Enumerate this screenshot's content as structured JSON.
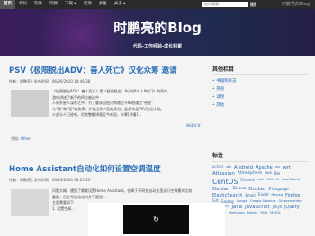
{
  "nav": {
    "items": [
      "首页",
      "代码",
      "软件",
      "玩物",
      "下载 ▾",
      "资源",
      "手册",
      "关于 ▾"
    ],
    "search_placeholder": "站内搜索...",
    "search_button": "搜索",
    "site_name": "时鹏亮的Blog"
  },
  "banner": {
    "title": "时鹏亮的Blog",
    "subtitle": "代码-工作经验-成长积累"
  },
  "posts": [
    {
      "title": "PSV《极限脱出ADV：善人死亡》汉化众筹 邀请",
      "meta": "作者：时鹏亮 | 发布时间：06/26/2020 14:46:38",
      "excerpt": [
        "《极限脱出ADV：善人死亡》是《极限脱出：9小时9个人9扇门》的续作。",
        "游戏讲述了新手的四位被选中",
        "人同外星人谋杀之中，为了重获自由只得通过不断地通过“密室”",
        "与“善”和“恶”的抉择，并找出杀人犯的身份。此部作品PSV汉化计划。",
        "少部分人已经有，但完整翻译版至今难觅，众筹[详情]..."
      ],
      "readmore": "阅读全文",
      "tag_label": "归档:",
      "tag_value": "Other"
    },
    {
      "title": "Home Assistant自动化如何设置空调温度",
      "meta": "作者：时鹏亮 | 发布时间：06/19/2020 06:25:35",
      "excerpt": [
        "问题大概，遇到了需要设置Home Assistant。在属于不同在自动化里运行空调模式比较",
        "重要，但在写自动化时并不是很...",
        "主要需要如下",
        "1. 设置空调…"
      ]
    }
  ],
  "sidebar": {
    "categories_title": "其他栏目",
    "categories": [
      "书籍和杂志",
      "英语",
      "读物",
      "其他"
    ],
    "tags_title": "标签",
    "tags": [
      "ACMES",
      "afb",
      "Android",
      "Apache",
      "aur",
      "wrt",
      "Atlassian",
      "Atmosphere",
      "AWS",
      "Ble",
      "CentOS",
      "Chrome",
      "cool",
      "CSS",
      "ctf",
      "DashStartes",
      "Debian",
      "Discuz",
      "Docker",
      "E'language",
      "ElasticSearch",
      "Email",
      "Excel",
      "ffmpeg",
      "Firefox",
      "Git",
      "Golang",
      "Google",
      "Google Adwords",
      "Greasemonkey",
      "HTML",
      "IIS",
      "Java",
      "JavaScript",
      "Jekyll",
      "jQuery",
      "Linux",
      "Markdown",
      "Maven",
      "Mint",
      "MySQL"
    ]
  },
  "overlay": {
    "icon": "replay-icon",
    "glyph": "↻"
  }
}
